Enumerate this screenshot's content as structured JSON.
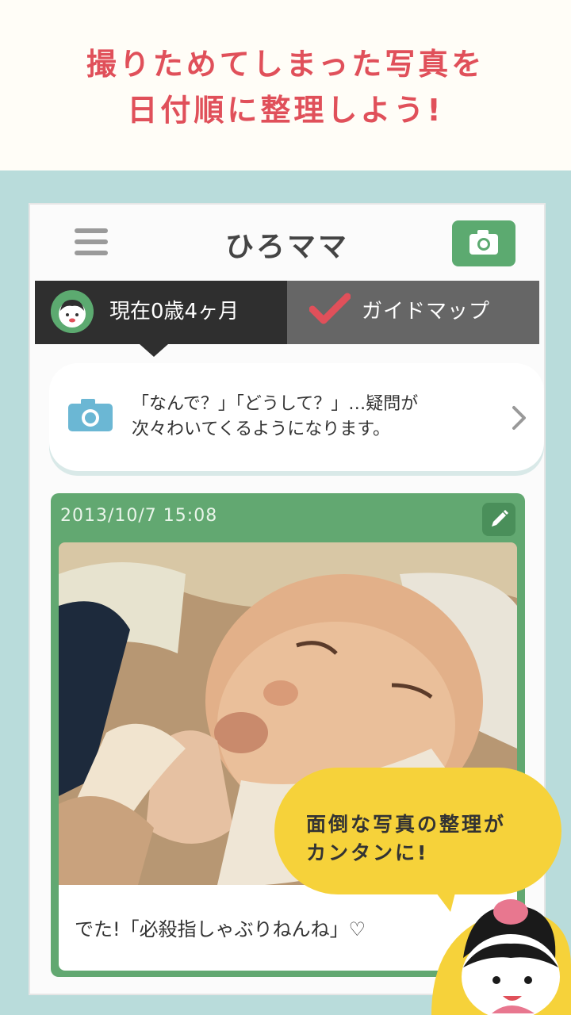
{
  "headline": {
    "line1": "撮りためてしまった写真を",
    "line2": "日付順に整理しよう!"
  },
  "app": {
    "title": "ひろママ",
    "age_label": "現在0歳4ヶ月",
    "guide_label": "ガイドマップ"
  },
  "tip": {
    "line1": "「なんで？」「どうして？」…疑問が",
    "line2": "次々わいてくるようになります。"
  },
  "entry": {
    "date": "2013/10/7 15:08",
    "caption": "でた!「必殺指しゃぶりねんね」♡"
  },
  "speech": {
    "line1": "面倒な写真の整理が",
    "line2": "カンタンに!"
  },
  "colors": {
    "accent_red": "#e0505a",
    "brand_green": "#5caa70",
    "teal_bg": "#b9dcdb",
    "bubble_yellow": "#f6d23a"
  }
}
